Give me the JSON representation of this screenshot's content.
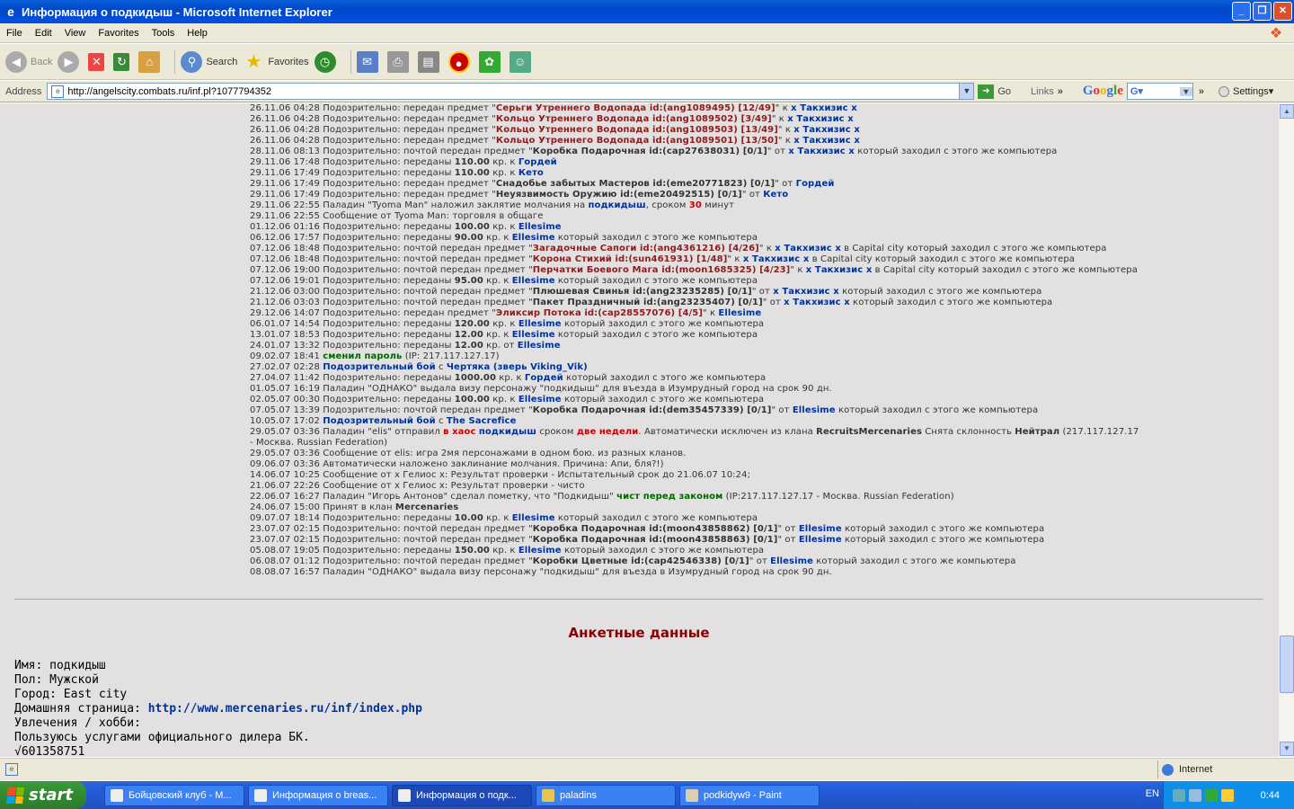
{
  "window": {
    "title": "Информация о подкидыш - Microsoft Internet Explorer"
  },
  "menu": [
    "File",
    "Edit",
    "View",
    "Favorites",
    "Tools",
    "Help"
  ],
  "toolbar": {
    "back": "Back",
    "search": "Search",
    "favorites": "Favorites"
  },
  "address": {
    "label": "Address",
    "url": "http://angelscity.combats.ru/inf.pl?1077794352",
    "go": "Go",
    "links": "Links",
    "google": "Google",
    "settings": "Settings"
  },
  "log": [
    [
      [
        "26.11.06 04:28 Подозрительно: передан предмет \"",
        "n"
      ],
      [
        "Серьги Утреннего Водопада id:(ang1089495) [12/49]",
        "i"
      ],
      [
        "\" к ",
        "n"
      ],
      [
        "x Такхизис x",
        "u"
      ]
    ],
    [
      [
        "26.11.06 04:28 Подозрительно: передан предмет \"",
        "n"
      ],
      [
        "Кольцо Утреннего Водопада id:(ang1089502) [3/49]",
        "i"
      ],
      [
        "\" к ",
        "n"
      ],
      [
        "x Такхизис x",
        "u"
      ]
    ],
    [
      [
        "26.11.06 04:28 Подозрительно: передан предмет \"",
        "n"
      ],
      [
        "Кольцо Утреннего Водопада id:(ang1089503) [13/49]",
        "i"
      ],
      [
        "\" к ",
        "n"
      ],
      [
        "x Такхизис x",
        "u"
      ]
    ],
    [
      [
        "26.11.06 04:28 Подозрительно: передан предмет \"",
        "n"
      ],
      [
        "Кольцо Утреннего Водопада id:(ang1089501) [13/50]",
        "i"
      ],
      [
        "\" к ",
        "n"
      ],
      [
        "x Такхизис x",
        "u"
      ]
    ],
    [
      [
        "28.11.06 08:13 Подозрительно: почтой передан предмет \"",
        "n"
      ],
      [
        "Коробка Подарочная id:(cap27638031) [0/1]",
        "b"
      ],
      [
        "\" от ",
        "n"
      ],
      [
        "x Такхизис x",
        "u"
      ],
      [
        " который заходил с этого же компьютера",
        "n"
      ]
    ],
    [
      [
        "29.11.06 17:48 Подозрительно: переданы ",
        "n"
      ],
      [
        "110.00",
        "b"
      ],
      [
        " кр. к ",
        "n"
      ],
      [
        "Гордей",
        "u"
      ]
    ],
    [
      [
        "29.11.06 17:49 Подозрительно: переданы ",
        "n"
      ],
      [
        "110.00",
        "b"
      ],
      [
        " кр. к ",
        "n"
      ],
      [
        "Кето",
        "u"
      ]
    ],
    [
      [
        "29.11.06 17:49 Подозрительно: передан предмет \"",
        "n"
      ],
      [
        "Снадобье забытых Мастеров id:(eme20771823) [0/1]",
        "b"
      ],
      [
        "\" от ",
        "n"
      ],
      [
        "Гордей",
        "u"
      ]
    ],
    [
      [
        "29.11.06 17:49 Подозрительно: передан предмет \"",
        "n"
      ],
      [
        "Неуязвимость Оружию id:(eme20492515) [0/1]",
        "b"
      ],
      [
        "\" от ",
        "n"
      ],
      [
        "Кето",
        "u"
      ]
    ],
    [
      [
        "29.11.06 22:55 Паладин \"Tyoma Man\" наложил заклятие молчания на ",
        "n"
      ],
      [
        "подкидыш",
        "u"
      ],
      [
        ", сроком ",
        "n"
      ],
      [
        "30",
        "r"
      ],
      [
        " минут",
        "n"
      ]
    ],
    [
      [
        "29.11.06 22:55 Сообщение от Tyoma Man: торговля в общаге",
        "n"
      ]
    ],
    [
      [
        "01.12.06 01:16 Подозрительно: переданы ",
        "n"
      ],
      [
        "100.00",
        "b"
      ],
      [
        " кр. к ",
        "n"
      ],
      [
        "Ellesime",
        "u"
      ]
    ],
    [
      [
        "06.12.06 17:57 Подозрительно: переданы ",
        "n"
      ],
      [
        "90.00",
        "b"
      ],
      [
        " кр. к ",
        "n"
      ],
      [
        "Ellesime",
        "u"
      ],
      [
        " который заходил с этого же компьютера",
        "n"
      ]
    ],
    [
      [
        "07.12.06 18:48 Подозрительно: почтой передан предмет \"",
        "n"
      ],
      [
        "Загадочные Сапоги id:(ang4361216) [4/26]",
        "i"
      ],
      [
        "\" к ",
        "n"
      ],
      [
        "x Такхизис x",
        "u"
      ],
      [
        " в Capital city который заходил с этого же компьютера",
        "n"
      ]
    ],
    [
      [
        "07.12.06 18:48 Подозрительно: почтой передан предмет \"",
        "n"
      ],
      [
        "Корона Стихий id:(sun461931) [1/48]",
        "i"
      ],
      [
        "\" к ",
        "n"
      ],
      [
        "x Такхизис x",
        "u"
      ],
      [
        " в Capital city который заходил с этого же компьютера",
        "n"
      ]
    ],
    [
      [
        "07.12.06 19:00 Подозрительно: почтой передан предмет \"",
        "n"
      ],
      [
        "Перчатки Боевого Мага id:(moon1685325) [4/23]",
        "i"
      ],
      [
        "\" к ",
        "n"
      ],
      [
        "x Такхизис x",
        "u"
      ],
      [
        " в Capital city который заходил с этого же компьютера",
        "n"
      ]
    ],
    [
      [
        "07.12.06 19:01 Подозрительно: переданы ",
        "n"
      ],
      [
        "95.00",
        "b"
      ],
      [
        " кр. к ",
        "n"
      ],
      [
        "Ellesime",
        "u"
      ],
      [
        " который заходил с этого же компьютера",
        "n"
      ]
    ],
    [
      [
        "21.12.06 03:00 Подозрительно: почтой передан предмет \"",
        "n"
      ],
      [
        "Плюшевая Свинья id:(ang23235285) [0/1]",
        "b"
      ],
      [
        "\" от ",
        "n"
      ],
      [
        "x Такхизис x",
        "u"
      ],
      [
        " который заходил с этого же компьютера",
        "n"
      ]
    ],
    [
      [
        "21.12.06 03:03 Подозрительно: почтой передан предмет \"",
        "n"
      ],
      [
        "Пакет Праздничный id:(ang23235407) [0/1]",
        "b"
      ],
      [
        "\" от ",
        "n"
      ],
      [
        "x Такхизис x",
        "u"
      ],
      [
        " который заходил с этого же компьютера",
        "n"
      ]
    ],
    [
      [
        "29.12.06 14:07 Подозрительно: передан предмет \"",
        "n"
      ],
      [
        "Эликсир Потока id:(cap28557076) [4/5]",
        "i"
      ],
      [
        "\" к ",
        "n"
      ],
      [
        "Ellesime",
        "u"
      ]
    ],
    [
      [
        "06.01.07 14:54 Подозрительно: переданы ",
        "n"
      ],
      [
        "120.00",
        "b"
      ],
      [
        " кр. к ",
        "n"
      ],
      [
        "Ellesime",
        "u"
      ],
      [
        " который заходил с этого же компьютера",
        "n"
      ]
    ],
    [
      [
        "13.01.07 18:53 Подозрительно: переданы ",
        "n"
      ],
      [
        "12.00",
        "b"
      ],
      [
        " кр. к ",
        "n"
      ],
      [
        "Ellesime",
        "u"
      ],
      [
        " который заходил с этого же компьютера",
        "n"
      ]
    ],
    [
      [
        "24.01.07 13:32 Подозрительно: переданы ",
        "n"
      ],
      [
        "12.00",
        "b"
      ],
      [
        " кр. от ",
        "n"
      ],
      [
        "Ellesime",
        "u"
      ]
    ],
    [
      [
        "09.02.07 18:41 ",
        "n"
      ],
      [
        "сменил пароль",
        "g"
      ],
      [
        " (IP: 217.117.127.17)",
        "n"
      ]
    ],
    [
      [
        "27.02.07 02:28 ",
        "n"
      ],
      [
        "Подозрительный бой",
        "u"
      ],
      [
        " с ",
        "n"
      ],
      [
        "Чертяка (зверь Viking_Vik)",
        "u"
      ]
    ],
    [
      [
        "27.04.07 11:42 Подозрительно: переданы ",
        "n"
      ],
      [
        "1000.00",
        "b"
      ],
      [
        " кр. к ",
        "n"
      ],
      [
        "Гордей",
        "u"
      ],
      [
        " который заходил с этого же компьютера",
        "n"
      ]
    ],
    [
      [
        "01.05.07 16:19 Паладин \"ОДНАКО\" выдала визу персонажу \"подкидыш\" для въезда в Изумрудный город на срок 90 дн.",
        "n"
      ]
    ],
    [
      [
        "02.05.07 00:30 Подозрительно: переданы ",
        "n"
      ],
      [
        "100.00",
        "b"
      ],
      [
        " кр. к ",
        "n"
      ],
      [
        "Ellesime",
        "u"
      ],
      [
        " который заходил с этого же компьютера",
        "n"
      ]
    ],
    [
      [
        "07.05.07 13:39 Подозрительно: почтой передан предмет \"",
        "n"
      ],
      [
        "Коробка Подарочная id:(dem35457339) [0/1]",
        "b"
      ],
      [
        "\" от ",
        "n"
      ],
      [
        "Ellesime",
        "u"
      ],
      [
        " который заходил с этого же компьютера",
        "n"
      ]
    ],
    [
      [
        "10.05.07 17:02 ",
        "n"
      ],
      [
        "Подозрительный бой",
        "u"
      ],
      [
        " с ",
        "n"
      ],
      [
        "The Sacrefice",
        "u"
      ]
    ],
    [
      [
        "29.05.07 03:36 Паладин \"elis\" отправил ",
        "n"
      ],
      [
        "в хаос",
        "r"
      ],
      [
        " ",
        "n"
      ],
      [
        "подкидыш",
        "u"
      ],
      [
        " сроком ",
        "n"
      ],
      [
        "две недели",
        "r"
      ],
      [
        ". Автоматически исключен из клана ",
        "n"
      ],
      [
        "RecruitsMercenaries",
        "b"
      ],
      [
        " Снята склонность ",
        "n"
      ],
      [
        "Нейтрал",
        "b"
      ],
      [
        " (217.117.127.17",
        "n"
      ]
    ],
    [
      [
        "- Москва. Russian Federation)",
        "n"
      ]
    ],
    [
      [
        "29.05.07 03:36 Сообщение от elis: игра 2мя персонажами в одном бою. из разных кланов.",
        "n"
      ]
    ],
    [
      [
        "09.06.07 03:36 Автоматически наложено заклинание молчания. Причина: Апи, бля?!)",
        "n"
      ]
    ],
    [
      [
        "14.06.07 10:25 Сообщение от x Гелиос x: Результат проверки - Испытательный срок до 21.06.07 10:24;",
        "n"
      ]
    ],
    [
      [
        "21.06.07 22:26 Сообщение от x Гелиос x: Результат проверки - чисто",
        "n"
      ]
    ],
    [
      [
        "22.06.07 16:27 Паладин \"Игорь Антонов\" сделал пометку, что \"Подкидыш\" ",
        "n"
      ],
      [
        "чист перед законом",
        "g"
      ],
      [
        " (IP:217.117.127.17 - Москва. Russian Federation)",
        "n"
      ]
    ],
    [
      [
        "24.06.07 15:00 Принят в клан ",
        "n"
      ],
      [
        "Mercenaries",
        "b"
      ]
    ],
    [
      [
        "09.07.07 18:14 Подозрительно: переданы ",
        "n"
      ],
      [
        "10.00",
        "b"
      ],
      [
        " кр. к ",
        "n"
      ],
      [
        "Ellesime",
        "u"
      ],
      [
        " который заходил с этого же компьютера",
        "n"
      ]
    ],
    [
      [
        "23.07.07 02:15 Подозрительно: почтой передан предмет \"",
        "n"
      ],
      [
        "Коробка Подарочная id:(moon43858862) [0/1]",
        "b"
      ],
      [
        "\" от ",
        "n"
      ],
      [
        "Ellesime",
        "u"
      ],
      [
        " который заходил с этого же компьютера",
        "n"
      ]
    ],
    [
      [
        "23.07.07 02:15 Подозрительно: почтой передан предмет \"",
        "n"
      ],
      [
        "Коробка Подарочная id:(moon43858863) [0/1]",
        "b"
      ],
      [
        "\" от ",
        "n"
      ],
      [
        "Ellesime",
        "u"
      ],
      [
        " который заходил с этого же компьютера",
        "n"
      ]
    ],
    [
      [
        "05.08.07 19:05 Подозрительно: переданы ",
        "n"
      ],
      [
        "150.00",
        "b"
      ],
      [
        " кр. к ",
        "n"
      ],
      [
        "Ellesime",
        "u"
      ],
      [
        " который заходил с этого же компьютера",
        "n"
      ]
    ],
    [
      [
        "06.08.07 01:12 Подозрительно: почтой передан предмет \"",
        "n"
      ],
      [
        "Коробки Цветные id:(cap42546338) [0/1]",
        "b"
      ],
      [
        "\" от ",
        "n"
      ],
      [
        "Ellesime",
        "u"
      ],
      [
        " который заходил с этого же компьютера",
        "n"
      ]
    ],
    [
      [
        "08.08.07 16:57 Паладин \"ОДНАКО\" выдала визу персонажу \"подкидыш\" для въезда в Изумрудный город на срок 90 дн.",
        "n"
      ]
    ]
  ],
  "colors": {
    "n": "#333333",
    "b": "#333333",
    "i": "#8b2020",
    "u": "#003399",
    "r": "#cc0000",
    "g": "#006600"
  },
  "anketa": {
    "title": "Анкетные данные",
    "name": "Имя: подкидыш",
    "sex": "Пол: Мужской",
    "city": "Город: East city",
    "homepage_label": "Домашняя страница: ",
    "homepage_url": "http://www.mercenaries.ru/inf/index.php",
    "hobby": "Увлечения / хобби:",
    "line1": "Пользуюсь услугами официального дилера БК.",
    "line2": "√601358751"
  },
  "status": {
    "zone": "Internet"
  },
  "taskbar": {
    "start": "start",
    "tasks": [
      "Бойцовский клуб - M...",
      "Информация о breas...",
      "Информация о подк...",
      "paladins",
      "podkidyw9 - Paint"
    ],
    "lang": "EN",
    "clock": "0:44"
  }
}
